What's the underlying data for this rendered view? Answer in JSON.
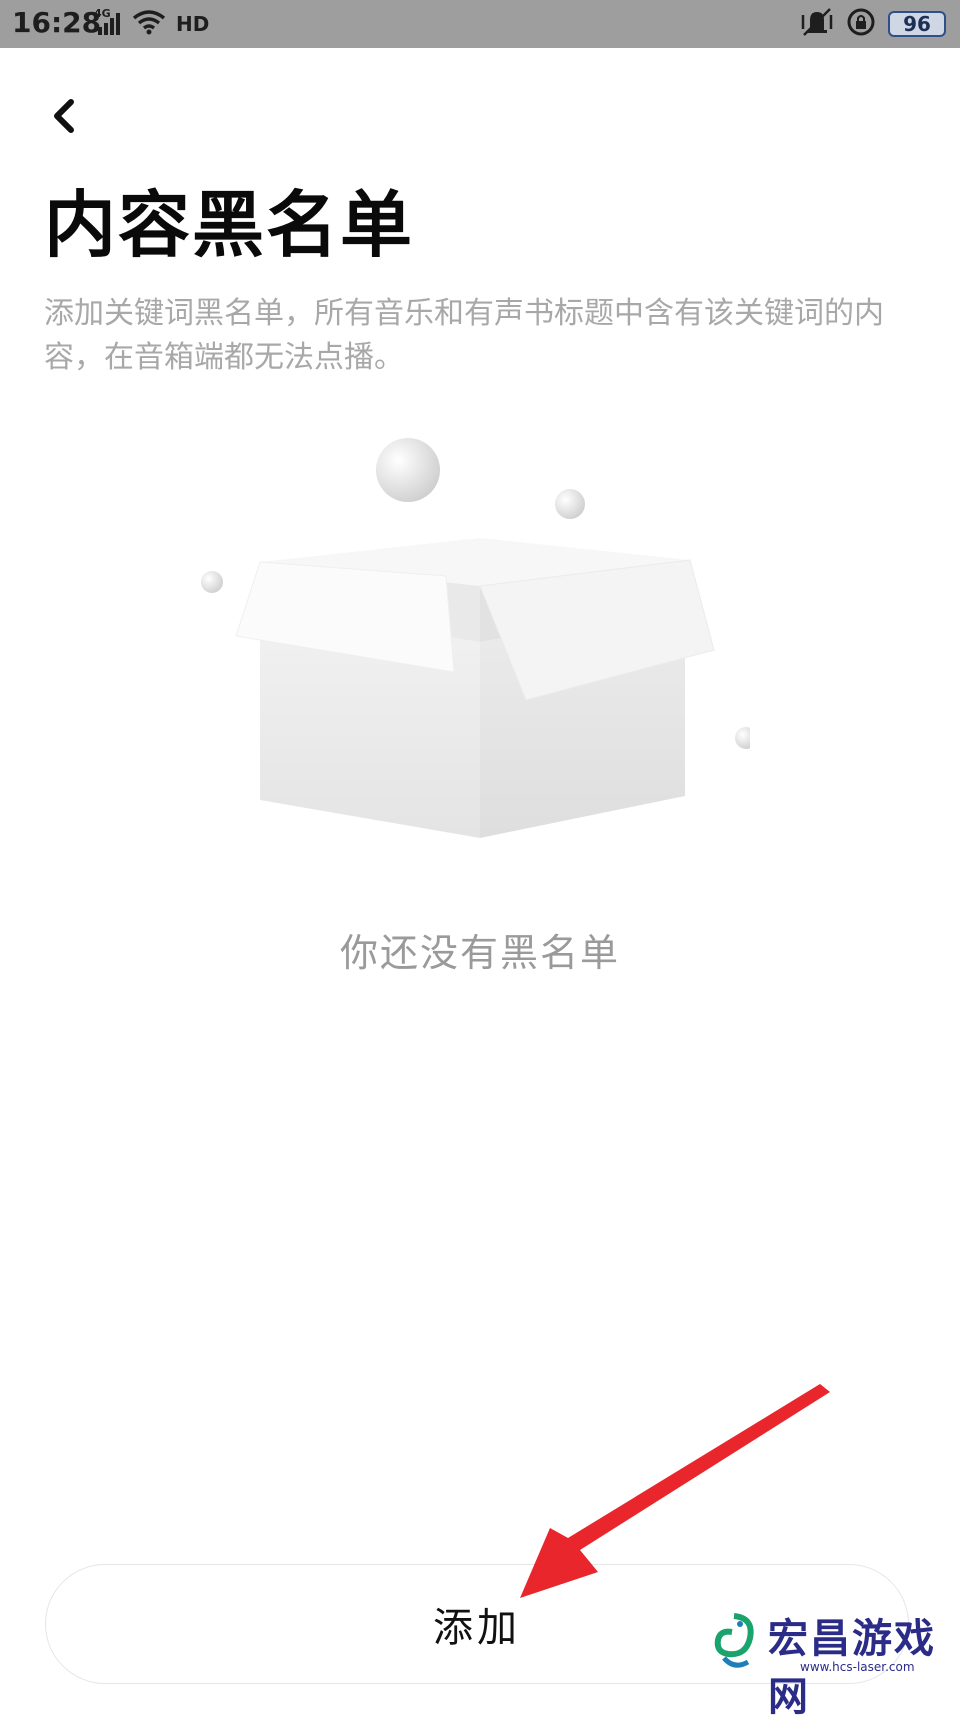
{
  "status_bar": {
    "time": "16:28",
    "network_label": "4G",
    "hd_label": "HD",
    "battery": "96",
    "icons": [
      "signal-icon",
      "wifi-icon",
      "hd-icon",
      "vibrate-icon",
      "rotation-lock-icon",
      "battery-icon"
    ]
  },
  "header": {
    "back_icon": "chevron-left-icon",
    "title": "内容黑名单",
    "description": "添加关键词黑名单，所有音乐和有声书标题中含有该关键词的内容，在音箱端都无法点播。"
  },
  "empty_state": {
    "illustration": "empty-box-icon",
    "text": "你还没有黑名单"
  },
  "footer": {
    "add_label": "添加"
  },
  "annotation": {
    "arrow_color": "#e8262c"
  },
  "watermark": {
    "text": "宏昌游戏网",
    "sub": "www.hcs-laser.com"
  }
}
